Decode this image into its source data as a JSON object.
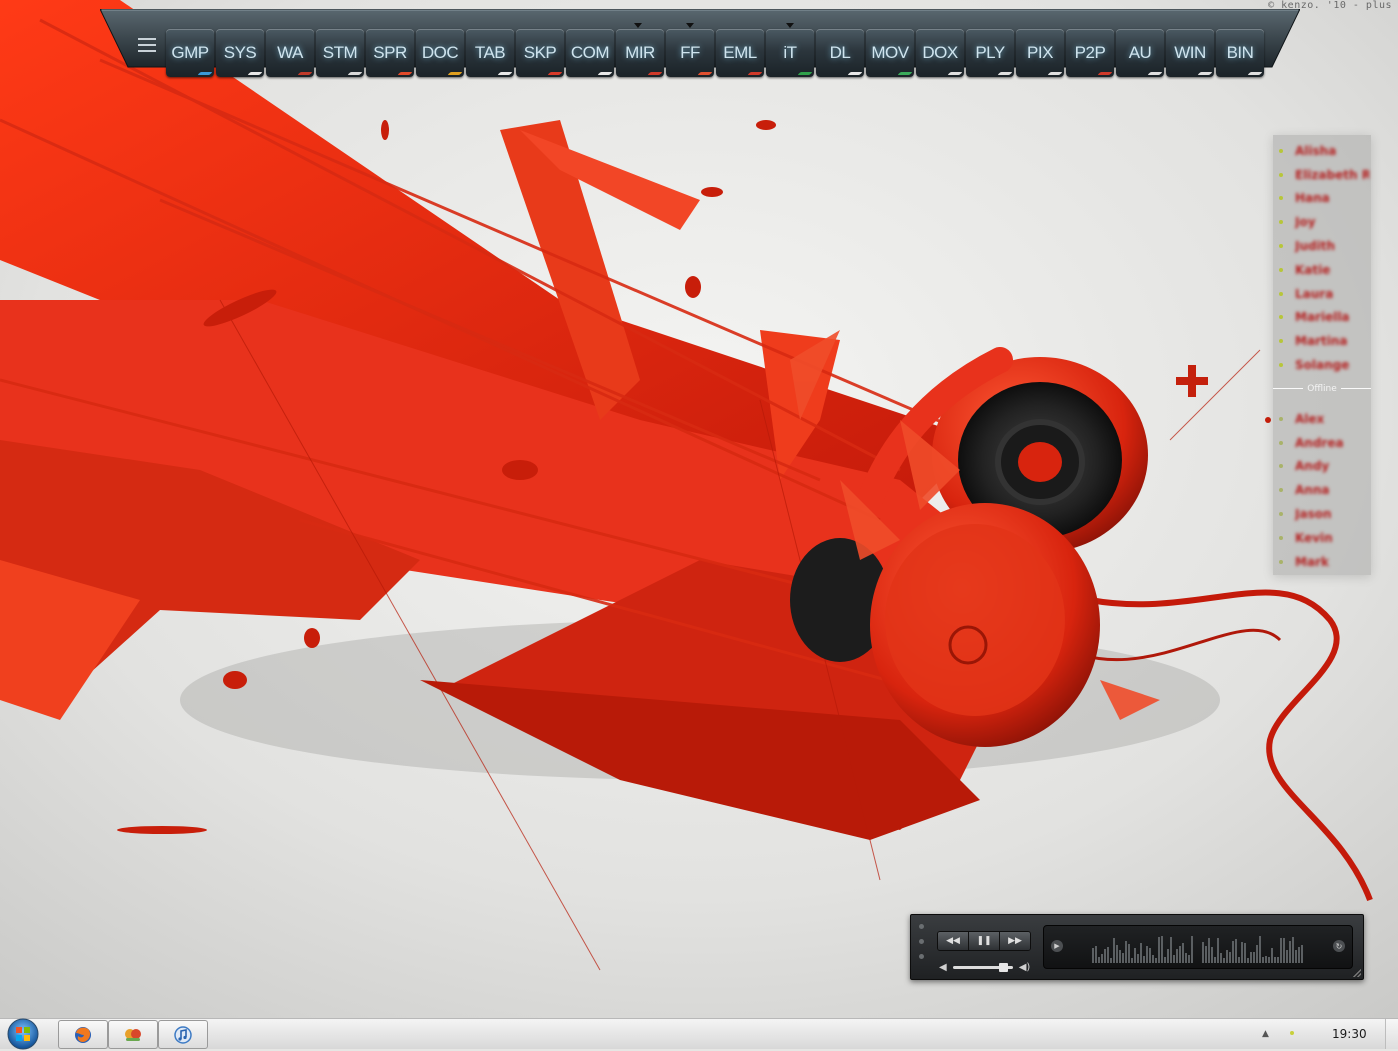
{
  "credit": "© kenzo. '10 - plus",
  "dock": {
    "items": [
      {
        "label": "GMP",
        "accent": "#3a9ad9"
      },
      {
        "label": "SYS",
        "accent": "#e8e8e8"
      },
      {
        "label": "WA",
        "accent": "#c03a2a"
      },
      {
        "label": "STM",
        "accent": "#d9d9d9"
      },
      {
        "label": "SPR",
        "accent": "#e24a2a"
      },
      {
        "label": "DOC",
        "accent": "#e0a020"
      },
      {
        "label": "TAB",
        "accent": "#e8e8e8"
      },
      {
        "label": "SKP",
        "accent": "#d83a2a"
      },
      {
        "label": "COM",
        "accent": "#e8e8e8"
      },
      {
        "label": "MIR",
        "accent": "#d03a2a"
      },
      {
        "label": "FF",
        "accent": "#e05030"
      },
      {
        "label": "EML",
        "accent": "#d03a2a"
      },
      {
        "label": "iT",
        "accent": "#2fa04a"
      },
      {
        "label": "DL",
        "accent": "#e8e8e8"
      },
      {
        "label": "MOV",
        "accent": "#3aaa5a"
      },
      {
        "label": "DOX",
        "accent": "#e0e0e0"
      },
      {
        "label": "PLY",
        "accent": "#e0e0e0"
      },
      {
        "label": "PIX",
        "accent": "#e0e0e0"
      },
      {
        "label": "P2P",
        "accent": "#d03a2a"
      },
      {
        "label": "AU",
        "accent": "#e0e0e0"
      },
      {
        "label": "WIN",
        "accent": "#e0e0e0"
      },
      {
        "label": "BIN",
        "accent": "#e0e0e0"
      }
    ]
  },
  "contacts": {
    "online": [
      "Alisha",
      "Elizabeth R...",
      "Hana",
      "Joy",
      "Judith",
      "Katie",
      "Laura",
      "Mariella",
      "Martina",
      "Solange"
    ],
    "offline_label": "Offline",
    "offline": [
      "Alex",
      "Andrea",
      "Andy",
      "Anna",
      "Jason",
      "Kevin",
      "Mark"
    ]
  },
  "player": {
    "rewind_icon": "rewind-icon",
    "pause_icon": "pause-icon",
    "forward_icon": "fast-forward-icon",
    "volume_level": 0.85
  },
  "taskbar": {
    "clock": "19:30",
    "apps": [
      "firefox-icon",
      "messenger-icon",
      "itunes-icon"
    ]
  },
  "colors": {
    "accent": "#e8321c",
    "panel": "#2a3238"
  }
}
